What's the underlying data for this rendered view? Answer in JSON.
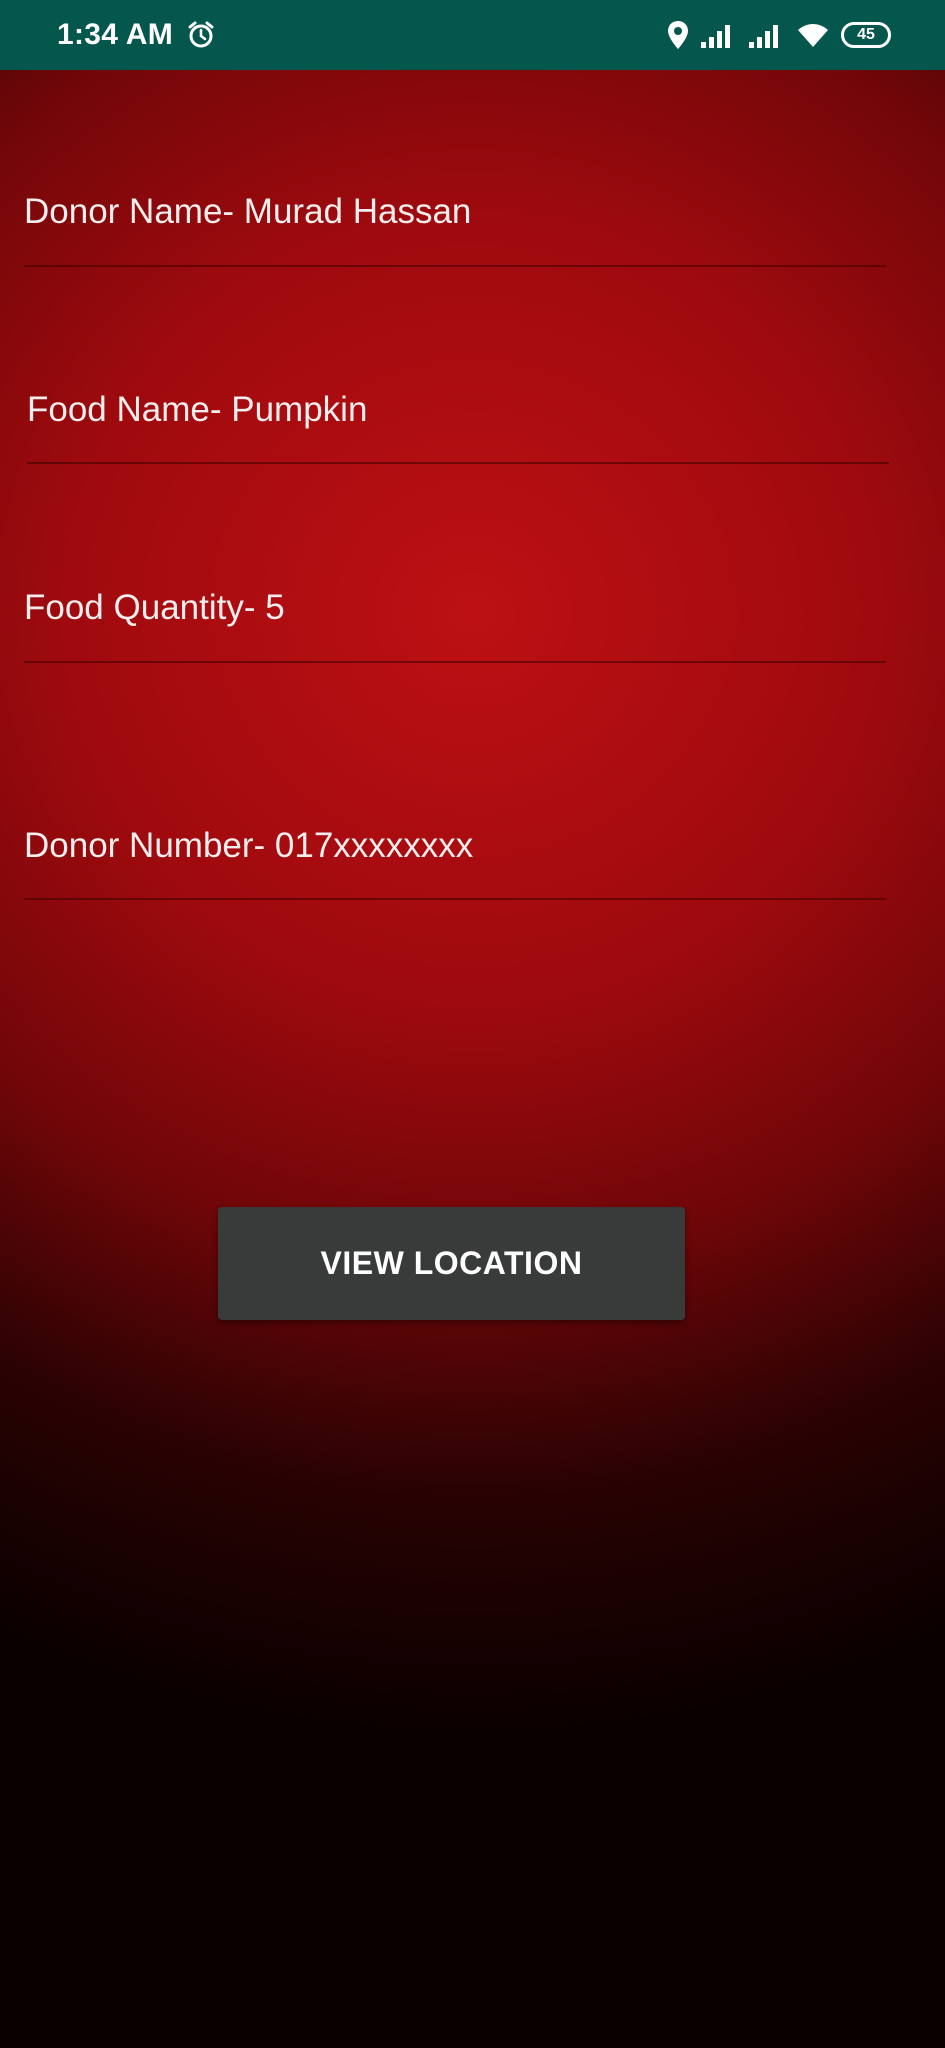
{
  "status_bar": {
    "time": "1:34 AM",
    "battery_level": "45",
    "icons": [
      "alarm-icon",
      "location-icon",
      "signal-icon",
      "signal-icon",
      "wifi-icon",
      "battery-icon"
    ],
    "background_color": "#05574e"
  },
  "fields": {
    "donor_name": "Donor Name- Murad Hassan",
    "food_name": "Food Name- Pumpkin",
    "food_quantity": "Food Quantity- 5",
    "donor_number": "Donor Number- 017xxxxxxxx"
  },
  "actions": {
    "view_location_label": "VIEW LOCATION"
  },
  "colors": {
    "background_red": "#a00d10",
    "button": "#393b3b"
  }
}
